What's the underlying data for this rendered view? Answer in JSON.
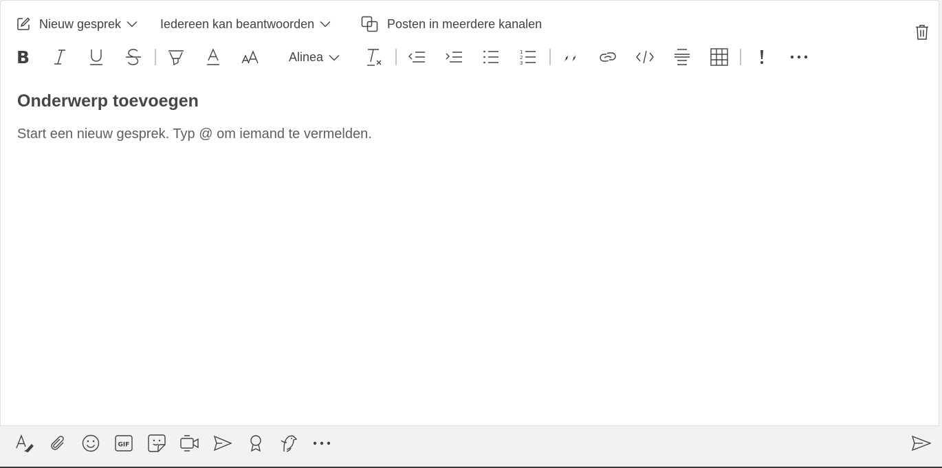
{
  "header": {
    "new_conversation_label": "Nieuw gesprek",
    "reply_setting_label": "Iedereen kan beantwoorden",
    "crosspost_label": "Posten in meerdere kanalen"
  },
  "toolbar": {
    "paragraph_label": "Alinea",
    "buttons": [
      "bold",
      "italic",
      "underline",
      "strikethrough",
      "highlight",
      "font-color",
      "font-size",
      "paragraph",
      "clear-formatting",
      "decrease-indent",
      "increase-indent",
      "bulleted-list",
      "numbered-list",
      "quote",
      "link",
      "code-snippet",
      "horizontal-rule",
      "table",
      "mark-as-important",
      "more-options"
    ]
  },
  "editor": {
    "subject_placeholder": "Onderwerp toevoegen",
    "body_placeholder": "Start een nieuw gesprek. Typ @ om iemand te vermelden."
  },
  "bottom_toolbar": {
    "buttons": [
      "format",
      "attach",
      "emoji",
      "gif",
      "sticker",
      "meet-now",
      "stream",
      "praise",
      "praise-bird",
      "more-options",
      "send"
    ]
  },
  "colors": {
    "icon": "#424242",
    "placeholder": "#605e5c",
    "subject": "#484644",
    "background": "#f3f2f1"
  }
}
